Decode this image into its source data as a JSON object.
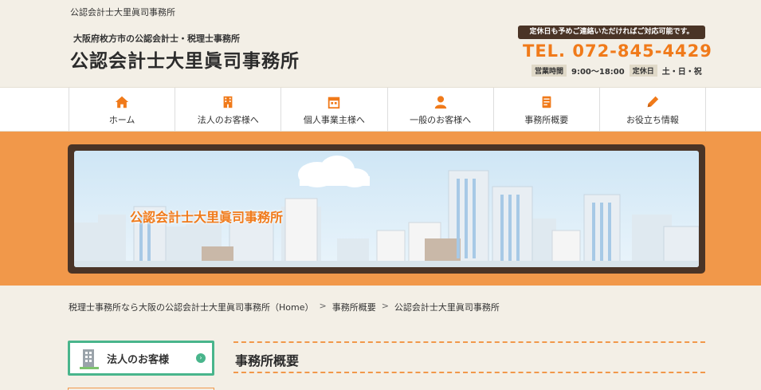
{
  "header": {
    "topline": "公認会計士大里眞司事務所",
    "subtitle": "大阪府枚方市の公認会計士・税理士事務所",
    "title": "公認会計士大里眞司事務所",
    "notice": "定休日も予めご連絡いただければご対応可能です。",
    "tel": "TEL. 072-845-4429",
    "hours_label": "営業時間",
    "hours_value": "9:00〜18:00",
    "closed_label": "定休日",
    "closed_value": "土・日・祝"
  },
  "nav": {
    "items": [
      {
        "label": "ホーム",
        "icon": "home-icon"
      },
      {
        "label": "法人のお客様へ",
        "icon": "building-icon"
      },
      {
        "label": "個人事業主様へ",
        "icon": "store-icon"
      },
      {
        "label": "一般のお客様へ",
        "icon": "person-icon"
      },
      {
        "label": "事務所概要",
        "icon": "document-icon"
      },
      {
        "label": "お役立ち情報",
        "icon": "pencil-icon"
      }
    ]
  },
  "banner": {
    "text": "公認会計士大里眞司事務所"
  },
  "breadcrumb": {
    "items": [
      "税理士事務所なら大阪の公認会計士大里眞司事務所（Home）",
      "事務所概要",
      "公認会計士大里眞司事務所"
    ],
    "separator": ">"
  },
  "sidebar": {
    "button_label": "法人のお客様",
    "arrow": "›"
  },
  "main": {
    "section_title": "事務所概要"
  },
  "colors": {
    "accent_orange": "#f07a1a",
    "banner_orange": "#f1984a",
    "dark_brown": "#4a3426",
    "green": "#49b58c"
  }
}
